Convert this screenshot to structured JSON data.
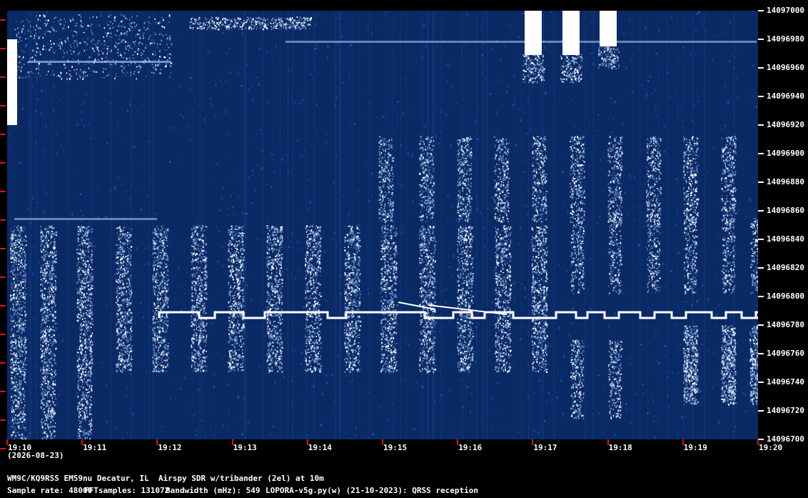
{
  "y_axis": {
    "labels": [
      "14097000",
      "14096980",
      "14096960",
      "14096940",
      "14096920",
      "14096900",
      "14096880",
      "14096860",
      "14096840",
      "14096820",
      "14096800",
      "14096780",
      "14096760",
      "14096740",
      "14096720",
      "14096700"
    ]
  },
  "x_axis": {
    "labels": [
      "19:10",
      "19:11",
      "19:12",
      "19:13",
      "19:14",
      "19:15",
      "19:16",
      "19:17",
      "19:18",
      "19:19",
      "19:20"
    ],
    "date": "(2026-08-23)"
  },
  "footer": {
    "station": "WM9C/KQ9RSS EM59nu Decatur, IL  Airspy SDR w/tribander (2el) at 10m",
    "sample_rate": "Sample rate: 48000",
    "fft_samples": "FFTsamples: 131072",
    "bandwidth": "Bandwidth (mHz): 549",
    "software": "LOPORA-v5g.py(w) (21-10-2023): QRSS reception"
  },
  "colors": {
    "background": "#000000",
    "waterfall": "#0a2a66",
    "signal": "#ffffff",
    "tick_marks": "#e01010"
  }
}
